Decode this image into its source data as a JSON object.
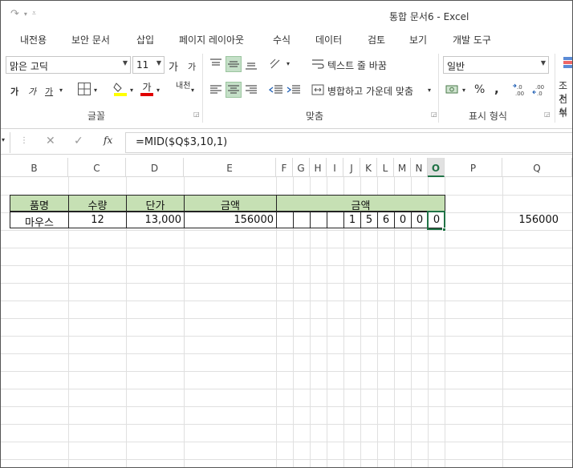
{
  "window": {
    "title": "통합 문서6 - Excel"
  },
  "tabs": [
    "내전용",
    "보안 문서",
    "삽입",
    "페이지 레이아웃",
    "수식",
    "데이터",
    "검토",
    "보기",
    "개발 도구"
  ],
  "ribbon": {
    "font_name": "맑은 고딕",
    "font_size": "11",
    "grow_font": "가",
    "shrink_font": "가",
    "bold": "가",
    "italic": "가",
    "underline": "가",
    "font_color_glyph": "가",
    "phonetic": "내천",
    "wrap_text": "텍스트 줄 바꿈",
    "merge_center": "병합하고 가운데 맞춤",
    "number_format": "일반",
    "percent": "%",
    "comma": ",",
    "cond_format": "조건부",
    "cond_format_2": "서식",
    "groups": {
      "font": "글꼴",
      "alignment": "맞춤",
      "number": "표시 형식"
    }
  },
  "formula_bar": {
    "cancel": "✕",
    "enter": "✓",
    "fx": "fx",
    "formula": "=MID($Q$3,10,1)"
  },
  "columns": [
    "B",
    "C",
    "D",
    "E",
    "F",
    "G",
    "H",
    "I",
    "J",
    "K",
    "L",
    "M",
    "N",
    "O",
    "P",
    "Q"
  ],
  "active_column": "O",
  "table": {
    "headers": [
      "품명",
      "수량",
      "단가",
      "금액",
      "금액"
    ],
    "row": {
      "item": "마우스",
      "qty": "12",
      "price": "13,000",
      "amount": "156000",
      "digits": [
        "",
        "",
        "",
        "",
        "1",
        "5",
        "6",
        "0",
        "0",
        "0"
      ]
    }
  },
  "q3_value": "156000"
}
